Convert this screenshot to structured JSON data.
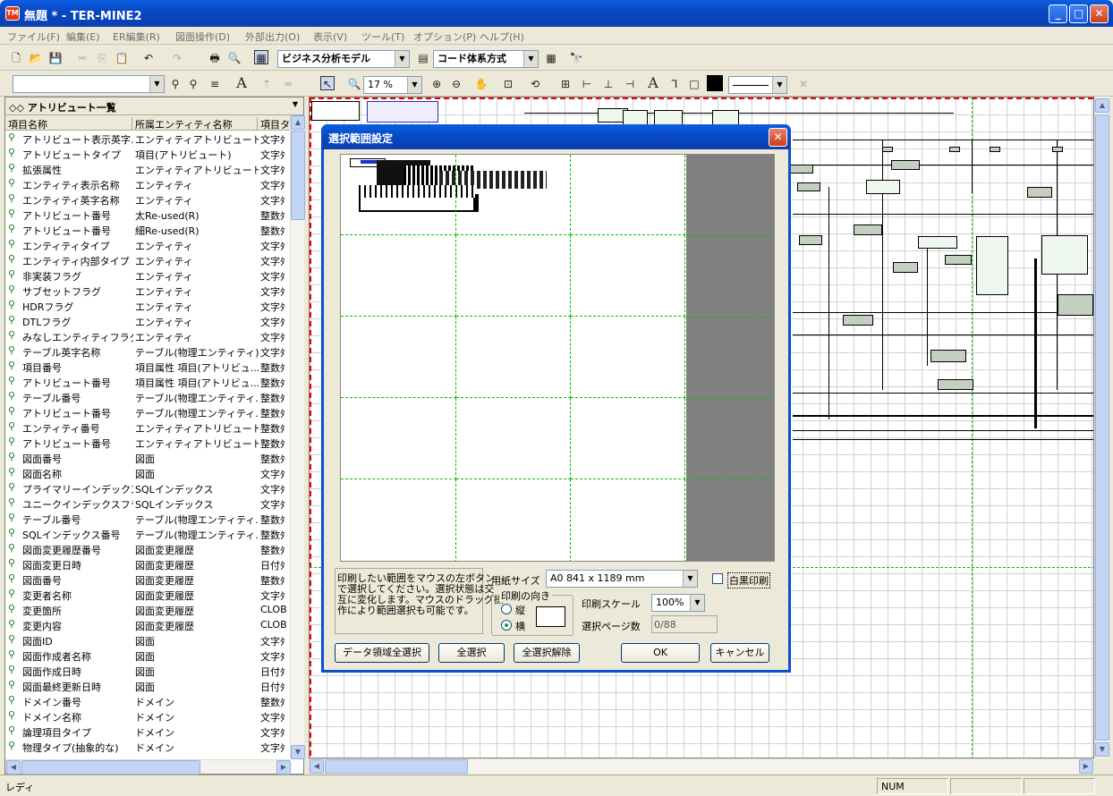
{
  "window": {
    "title": "無題 * - TER-MINE2",
    "icon": "app-icon"
  },
  "menu": [
    "ファイル(F)",
    "編集(E)",
    "ER編集(R)",
    "図面操作(D)",
    "外部出力(O)",
    "表示(V)",
    "ツール(T)",
    "オプション(P)",
    "ヘルプ(H)"
  ],
  "toolbar": {
    "model_select": "ビジネス分析モデル",
    "code_select": "コード体系方式",
    "zoom_value": "17 %"
  },
  "attribute_panel": {
    "title": "アトリビュート一覧",
    "columns": [
      "項目名称",
      "所属エンティティ名称",
      "項目タ"
    ],
    "rows": [
      [
        "アトリビュート表示英字...",
        "エンティティアトリビュート...",
        "文字ﾀ"
      ],
      [
        "アトリビュートタイプ",
        "項目(アトリビュート)",
        "文字ﾀ"
      ],
      [
        "拡張属性",
        "エンティティアトリビュート...",
        "文字ﾀ"
      ],
      [
        "エンティティ表示名称",
        "エンティティ",
        "文字ﾀ"
      ],
      [
        "エンティティ英字名称",
        "エンティティ",
        "文字ﾀ"
      ],
      [
        "アトリビュート番号",
        "太Re-used(R)",
        "整数ﾀ"
      ],
      [
        "アトリビュート番号",
        "細Re-used(R)",
        "整数ﾀ"
      ],
      [
        "エンティティタイプ",
        "エンティティ",
        "文字ﾀ"
      ],
      [
        "エンティティ内部タイプ",
        "エンティティ",
        "文字ﾀ"
      ],
      [
        "非実装フラグ",
        "エンティティ",
        "文字ﾀ"
      ],
      [
        "サブセットフラグ",
        "エンティティ",
        "文字ﾀ"
      ],
      [
        "HDRフラグ",
        "エンティティ",
        "文字ﾀ"
      ],
      [
        "DTLフラグ",
        "エンティティ",
        "文字ﾀ"
      ],
      [
        "みなしエンティティフラグ",
        "エンティティ",
        "文字ﾀ"
      ],
      [
        "テーブル英字名称",
        "テーブル(物理エンティティ)",
        "文字ﾀ"
      ],
      [
        "項目番号",
        "項目属性 項目(アトリビュ...",
        "整数ﾀ"
      ],
      [
        "アトリビュート番号",
        "項目属性 項目(アトリビュ...",
        "整数ﾀ"
      ],
      [
        "テーブル番号",
        "テーブル(物理エンティティ...",
        "整数ﾀ"
      ],
      [
        "アトリビュート番号",
        "テーブル(物理エンティティ...",
        "整数ﾀ"
      ],
      [
        "エンティティ番号",
        "エンティティアトリビュート...",
        "整数ﾀ"
      ],
      [
        "アトリビュート番号",
        "エンティティアトリビュート...",
        "整数ﾀ"
      ],
      [
        "図面番号",
        "図面",
        "整数ﾀ"
      ],
      [
        "図面名称",
        "図面",
        "文字ﾀ"
      ],
      [
        "プライマリーインデックスフ...",
        "SQLインデックス",
        "文字ﾀ"
      ],
      [
        "ユニークインデックスフラグ",
        "SQLインデックス",
        "文字ﾀ"
      ],
      [
        "テーブル番号",
        "テーブル(物理エンティティ...",
        "整数ﾀ"
      ],
      [
        "SQLインデックス番号",
        "テーブル(物理エンティティ...",
        "整数ﾀ"
      ],
      [
        "図面変更履歴番号",
        "図面変更履歴",
        "整数ﾀ"
      ],
      [
        "図面変更日時",
        "図面変更履歴",
        "日付ﾀ"
      ],
      [
        "図面番号",
        "図面変更履歴",
        "整数ﾀ"
      ],
      [
        "変更者名称",
        "図面変更履歴",
        "文字ﾀ"
      ],
      [
        "変更箇所",
        "図面変更履歴",
        "CLOB"
      ],
      [
        "変更内容",
        "図面変更履歴",
        "CLOB"
      ],
      [
        "図面ID",
        "図面",
        "文字ﾀ"
      ],
      [
        "図面作成者名称",
        "図面",
        "文字ﾀ"
      ],
      [
        "図面作成日時",
        "図面",
        "日付ﾀ"
      ],
      [
        "図面最終更新日時",
        "図面",
        "日付ﾀ"
      ],
      [
        "ドメイン番号",
        "ドメイン",
        "整数ﾀ"
      ],
      [
        "ドメイン名称",
        "ドメイン",
        "文字ﾀ"
      ],
      [
        "論理項目タイプ",
        "ドメイン",
        "文字ﾀ"
      ],
      [
        "物理タイプ(抽象的な)",
        "ドメイン",
        "文字ﾀ"
      ]
    ]
  },
  "dialog": {
    "title": "選択範囲設定",
    "instructions": [
      "印刷したい範囲をマウスの左ボタン",
      "で選択してください。選択状態は交",
      "互に変化します。マウスのドラッグ操",
      "作により範囲選択も可能です。"
    ],
    "paper_size_label": "用紙サイズ",
    "paper_size_value": "A0 841 x 1189 mm",
    "bw_print_label": "白黒印刷",
    "orientation_label": "印刷の向き",
    "portrait_label": "縦",
    "landscape_label": "横",
    "scale_label": "印刷スケール",
    "scale_value": "100%",
    "pages_label": "選択ページ数",
    "pages_value": "0/88",
    "btn_select_data": "データ領域全選択",
    "btn_select_all": "全選択",
    "btn_deselect_all": "全選択解除",
    "btn_ok": "OK",
    "btn_cancel": "キャンセル"
  },
  "status": {
    "text": "レディ",
    "num": "NUM"
  }
}
